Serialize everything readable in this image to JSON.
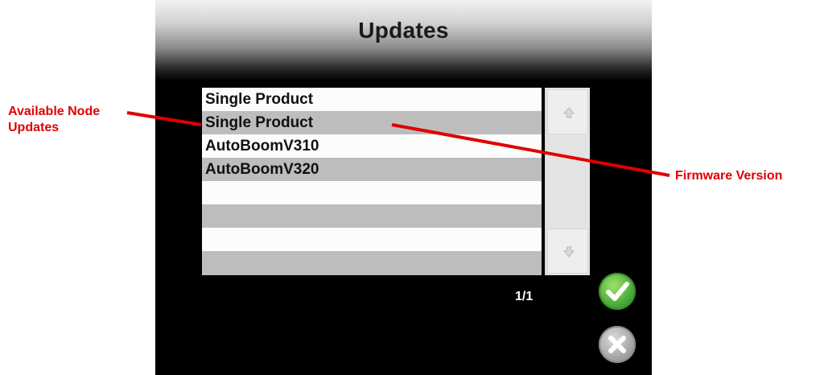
{
  "screen": {
    "title": "Updates",
    "list_items": [
      {
        "label": "Single Product"
      },
      {
        "label": "Single Product"
      },
      {
        "label": "AutoBoomV310"
      },
      {
        "label": "AutoBoomV320"
      },
      {
        "label": ""
      },
      {
        "label": ""
      },
      {
        "label": ""
      },
      {
        "label": ""
      }
    ],
    "pager": "1/1",
    "icons": {
      "scroll_up": "arrow-up-icon",
      "scroll_down": "arrow-down-icon",
      "accept": "checkmark-icon",
      "cancel": "close-icon"
    },
    "colors": {
      "accept": "#4caf3a",
      "cancel": "#a9a9a9",
      "callout": "#e00000"
    }
  },
  "annotations": {
    "left": "Available Node Updates",
    "right": "Firmware Version"
  }
}
